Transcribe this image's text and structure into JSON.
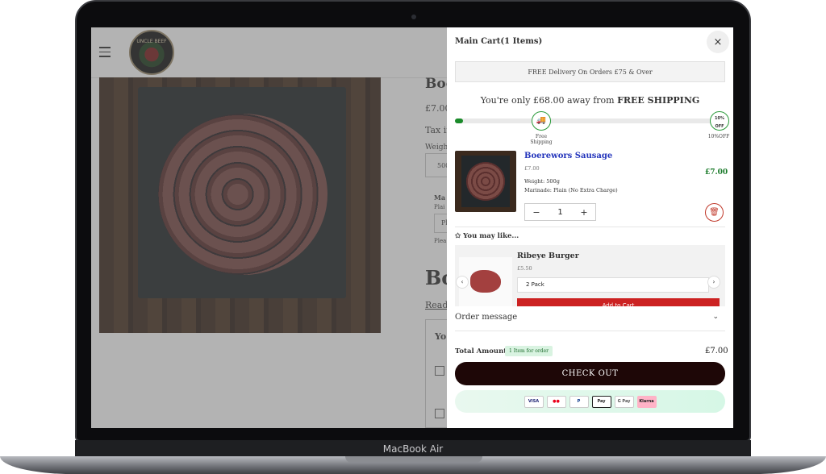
{
  "device": {
    "label": "MacBook Air"
  },
  "background_page": {
    "logo_text": "UNCLE BEEF",
    "title_fragment": "Boo",
    "price_fragment": "£7.00",
    "tax_fragment": "Tax in",
    "weight_fragment": "Weigh",
    "weight_box_fragment": "500",
    "marinade_fragment": "Ma",
    "marinade_value_fragment": "Plai",
    "select_fragment": "Pl",
    "please_fragment": "Plea",
    "title2_fragment": "Bo",
    "read_fragment": "Read",
    "section_fragment": "Yo"
  },
  "cart": {
    "title": "Main Cart(1 Items)",
    "close_label": "×",
    "free_delivery_banner": "FREE Delivery On Orders £75 & Over",
    "shipping_prefix": "You're only £68.00 away from ",
    "shipping_bold": "FREE SHIPPING",
    "progress_fraction": 0.03,
    "milestones": [
      {
        "badge": "🚚",
        "label_line1": "Free",
        "label_line2": "Shipping"
      },
      {
        "badge": "10% OFF",
        "label_line1": "10%OFF",
        "label_line2": ""
      }
    ],
    "item": {
      "name": "Boerewors Sausage",
      "unit_price": "£7.00",
      "line_price": "£7.00",
      "weight": "Weight: 500g",
      "marinade": "Marinade: Plain (No Extra Charge)",
      "quantity": "1",
      "minus": "−",
      "plus": "+",
      "remove_icon": "🗑"
    },
    "you_may_like": "✩ You may like...",
    "upsell": {
      "name": "Ribeye Burger",
      "price": "£5.50",
      "selected_option": "2 Pack",
      "add_label": "Add to Cart",
      "prev": "‹",
      "next": "›"
    },
    "order_message": "Order message",
    "order_chevron": "⌄",
    "total_label": "Total Amount",
    "total_badge": "1 Item for order",
    "total_amount": "£7.00",
    "checkout_label": "CHECK OUT",
    "payment_methods": [
      "VISA",
      "●●",
      "P",
      "Pay",
      "G Pay",
      "Klarna"
    ]
  },
  "colors": {
    "checkout_bg": "#1e0707",
    "accent_green": "#1a8a2a",
    "item_link": "#2233bb",
    "add_button": "#cc2222"
  }
}
